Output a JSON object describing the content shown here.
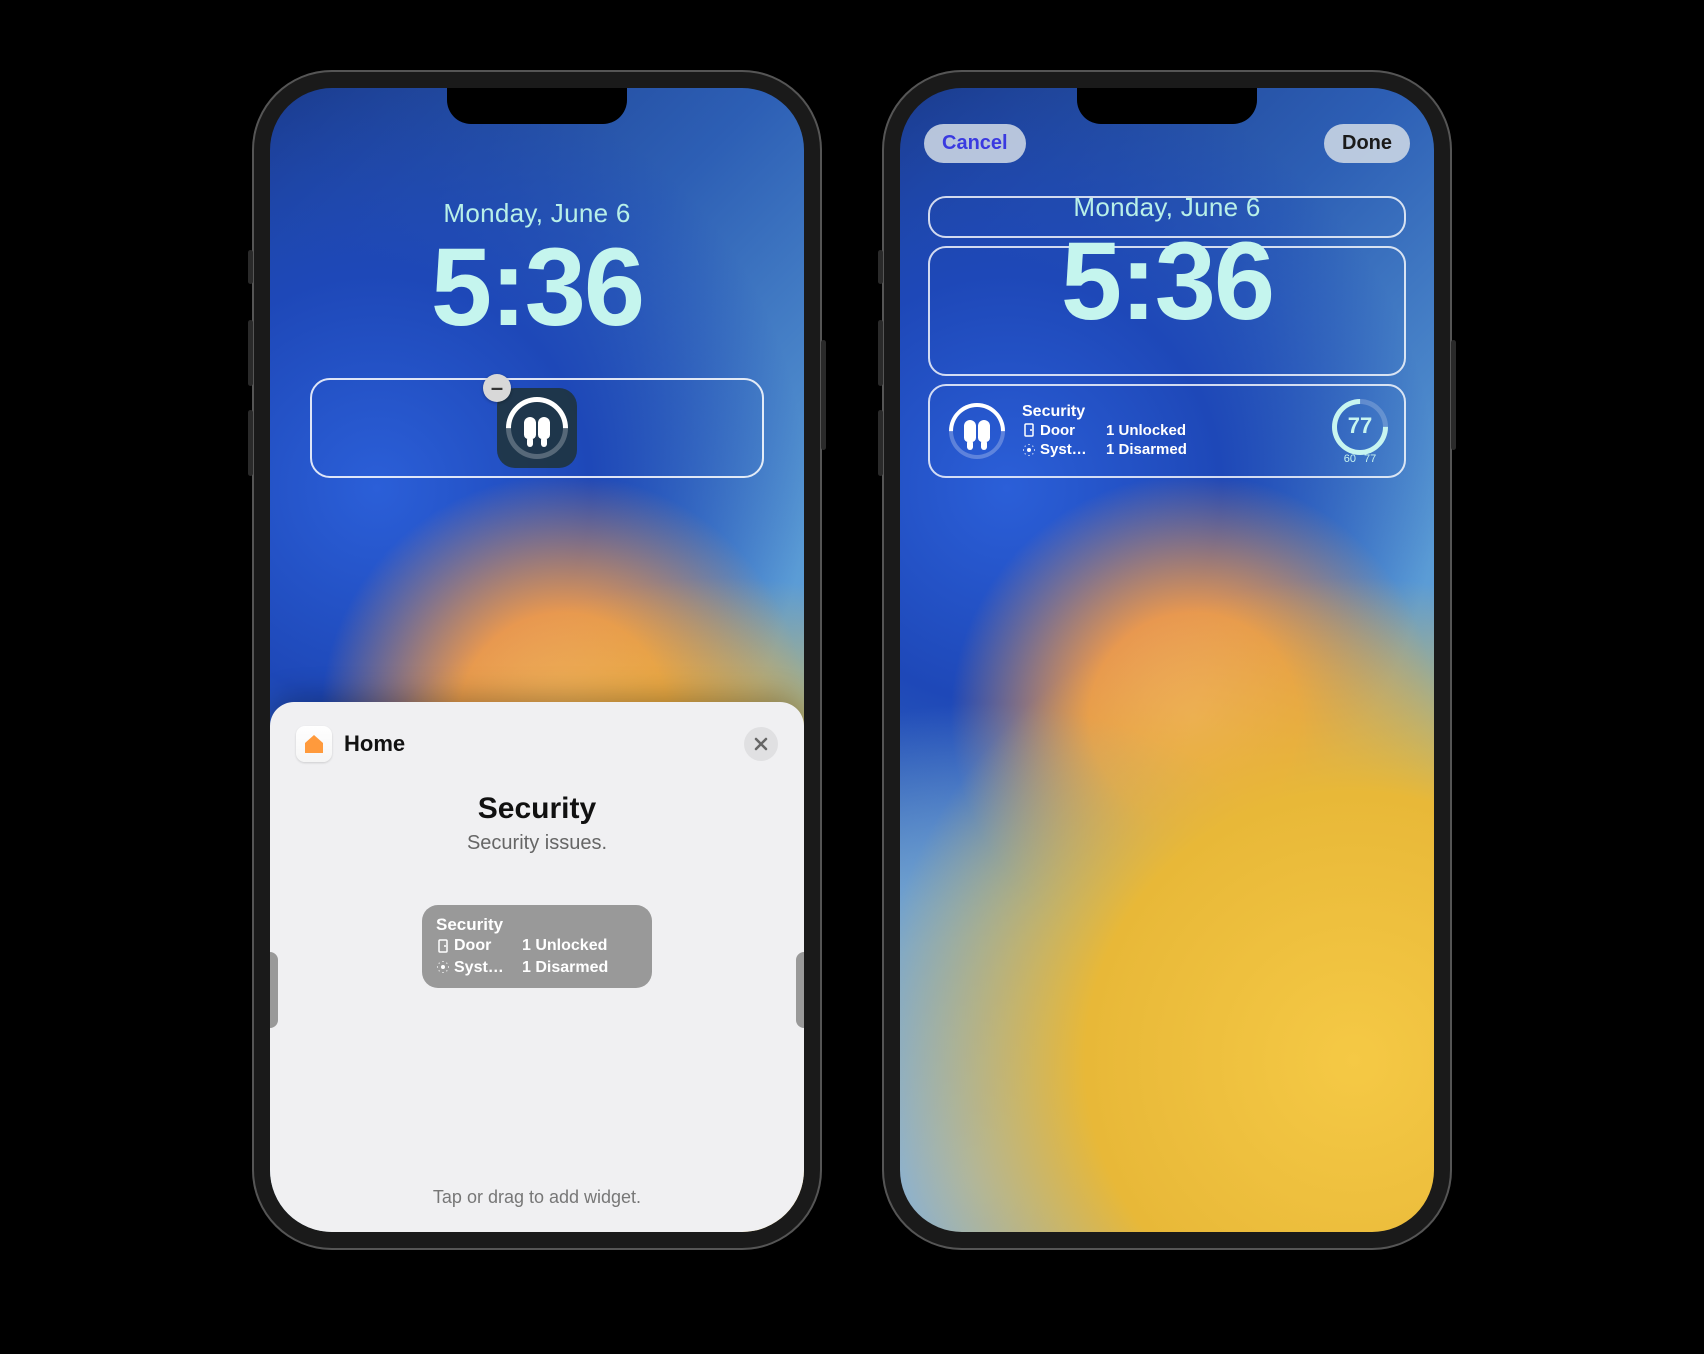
{
  "lockscreen": {
    "date": "Monday, June 6",
    "time": "5:36"
  },
  "editor": {
    "cancel": "Cancel",
    "done": "Done"
  },
  "widgets": {
    "remove_symbol": "–",
    "security": {
      "title": "Security",
      "rows": [
        {
          "label": "Door",
          "value": "1 Unlocked"
        },
        {
          "label": "Syst…",
          "value": "1 Disarmed"
        }
      ]
    },
    "gauge": {
      "value": "77",
      "low": "60",
      "high": "77"
    }
  },
  "sheet": {
    "app_name": "Home",
    "heading": "Security",
    "subheading": "Security issues.",
    "preview": {
      "title": "Security",
      "rows": [
        {
          "label": "Door",
          "value": "1 Unlocked"
        },
        {
          "label": "Syst…",
          "value": "1 Disarmed"
        }
      ]
    },
    "footer": "Tap or drag to add widget."
  }
}
